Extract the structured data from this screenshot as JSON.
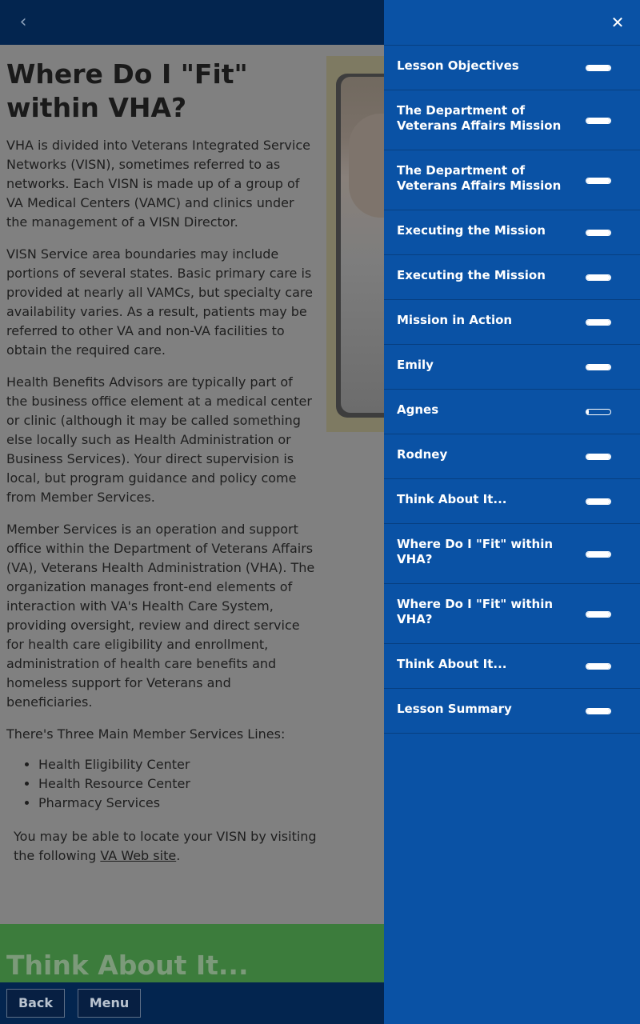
{
  "header": {
    "back_icon": "chevron-left-icon"
  },
  "lesson": {
    "title": "Where Do I \"Fit\" within VHA?",
    "paragraphs": [
      "VHA is divided into Veterans Integrated Service Networks (VISN), sometimes referred to as networks. Each VISN is made up of a group of VA Medical Centers (VAMC) and clinics under the management of a VISN Director.",
      "VISN Service area boundaries may include portions of several states. Basic primary care is provided at nearly all VAMCs, but specialty care availability varies. As a result, patients may be referred to other VA and non-VA facilities to obtain the required care.",
      "Health Benefits Advisors are typically part of the business office element at a medical center or clinic (although it may be called something else locally such as Health Administration or Business Services). Your direct supervision is local, but program guidance and policy come from Member Services.",
      "Member Services is an operation and support office within the Department of Veterans Affairs (VA), Veterans Health Administration (VHA). The organization manages front-end elements of interaction with VA's Health Care System, providing oversight, review and direct service for health care eligibility and enrollment, administration of health care benefits and homeless support for Veterans and beneficiaries.",
      "There's Three Main Member Services Lines:"
    ],
    "bullets": [
      "Health Eligibility Center",
      "Health Resource Center",
      "Pharmacy Services"
    ],
    "locate_prefix": "You may be able to locate your VISN by visiting the following ",
    "locate_link": "VA Web site",
    "locate_suffix": ".",
    "next_section_title": "Think About It..."
  },
  "footer": {
    "back_label": "Back",
    "menu_label": "Menu"
  },
  "drawer": {
    "close_icon": "close-icon",
    "close_glyph": "✕",
    "items": [
      {
        "label": "Lesson Objectives",
        "progress": 1.0
      },
      {
        "label": "The Department of Veterans Affairs Mission",
        "progress": 1.0
      },
      {
        "label": "The Department of Veterans Affairs Mission",
        "progress": 1.0
      },
      {
        "label": "Executing the Mission",
        "progress": 1.0
      },
      {
        "label": "Executing the Mission",
        "progress": 1.0
      },
      {
        "label": "Mission in Action",
        "progress": 1.0
      },
      {
        "label": "Emily",
        "progress": 1.0
      },
      {
        "label": "Agnes",
        "progress": 0.1
      },
      {
        "label": "Rodney",
        "progress": 1.0
      },
      {
        "label": "Think About It...",
        "progress": 1.0
      },
      {
        "label": "Where Do I \"Fit\" within VHA?",
        "progress": 1.0
      },
      {
        "label": "Where Do I \"Fit\" within VHA?",
        "progress": 1.0
      },
      {
        "label": "Think About It...",
        "progress": 1.0
      },
      {
        "label": "Lesson Summary",
        "progress": 1.0
      }
    ]
  }
}
